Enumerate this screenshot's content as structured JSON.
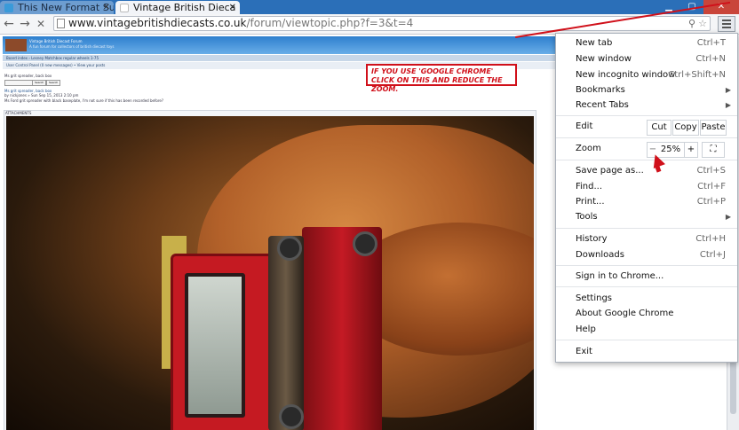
{
  "tabs": [
    {
      "label": "This New Format Suc",
      "active": false
    },
    {
      "label": "Vintage British Dieca",
      "active": true
    }
  ],
  "toolbar": {
    "url_host": "www.vintagebritishdiecasts.co.uk",
    "url_path": "/forum/viewtopic.php?f=3&t=4"
  },
  "page": {
    "forum_title": "Vintage British Diecast Forum",
    "forum_subtitle": "A fun forum for collectors of british diecast toys",
    "breadcrumb": "Board index › Lesney Matchbox regular wheels 1-75",
    "user_links": "User Control Panel (0 new messages) • View your posts",
    "topic_title": "Ms grit spreader, back box",
    "post_title": "Ms grit spreader, back box",
    "post_meta": "by nickjones » Sun Sep 15, 2013 2:10 pm",
    "post_body": "Ms Ford grit spreader with black baseplate, I'm not sure if this has been recorded before?",
    "search_label": "Search",
    "attachments_label": "ATTACHMENTS"
  },
  "annotation": {
    "text": "IF YOU USE 'GOOGLE CHROME' CLICK ON THIS AND REDUCE THE ZOOM."
  },
  "menu": {
    "new_tab": "New tab",
    "new_tab_sc": "Ctrl+T",
    "new_window": "New window",
    "new_window_sc": "Ctrl+N",
    "new_incognito": "New incognito window",
    "new_incognito_sc": "Ctrl+Shift+N",
    "bookmarks": "Bookmarks",
    "recent_tabs": "Recent Tabs",
    "edit": "Edit",
    "cut": "Cut",
    "copy": "Copy",
    "paste": "Paste",
    "zoom": "Zoom",
    "zoom_minus": "−",
    "zoom_value": "25%",
    "zoom_plus": "+",
    "save_page": "Save page as...",
    "save_page_sc": "Ctrl+S",
    "find": "Find...",
    "find_sc": "Ctrl+F",
    "print": "Print...",
    "print_sc": "Ctrl+P",
    "tools": "Tools",
    "history": "History",
    "history_sc": "Ctrl+H",
    "downloads": "Downloads",
    "downloads_sc": "Ctrl+J",
    "sign_in": "Sign in to Chrome...",
    "settings": "Settings",
    "about": "About Google Chrome",
    "help": "Help",
    "exit": "Exit"
  },
  "colors": {
    "annotation_red": "#d0101a",
    "titlebar_blue": "#2b6fb8"
  }
}
